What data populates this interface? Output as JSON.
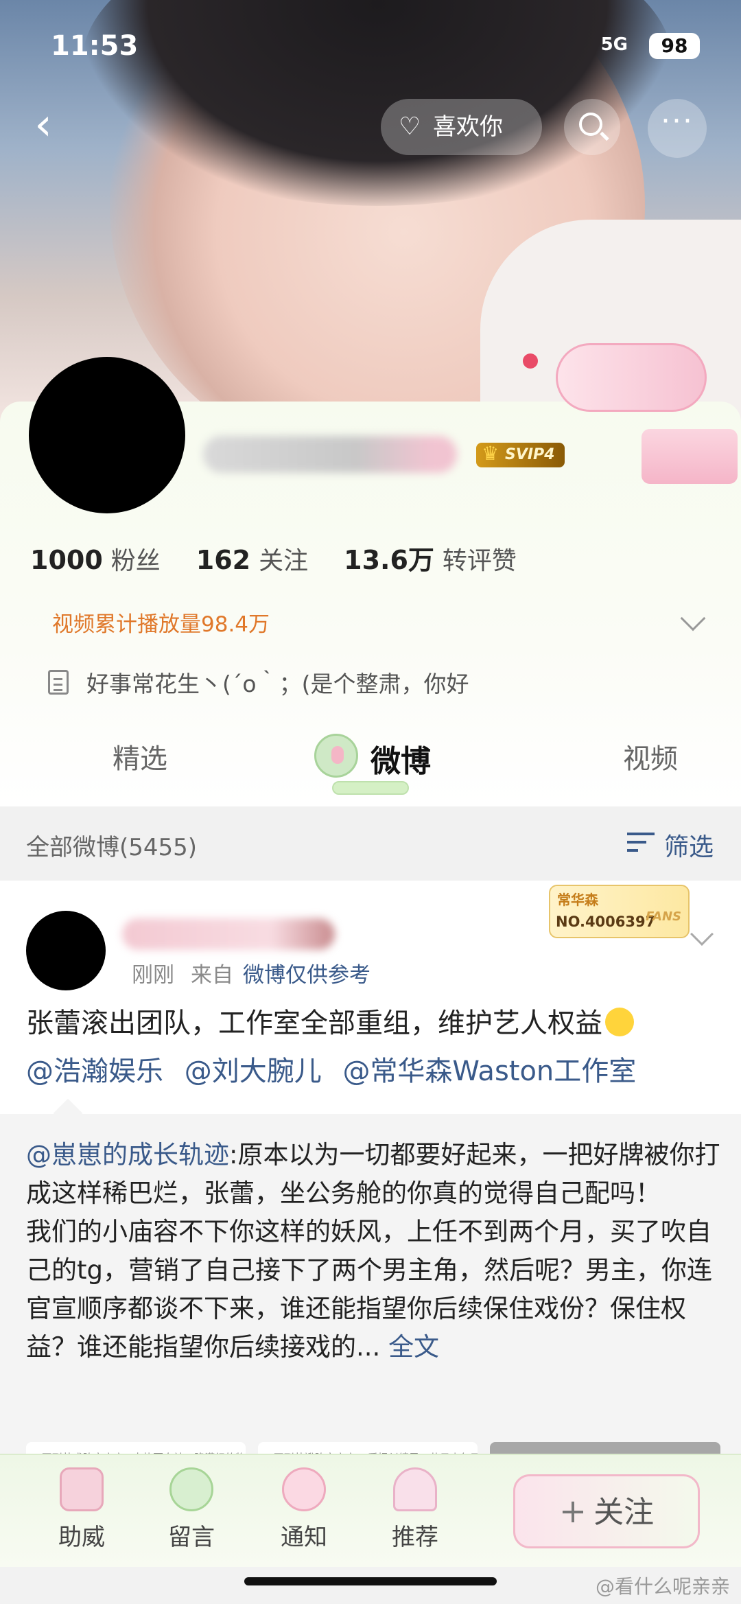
{
  "status_bar": {
    "time": "11:53",
    "network": "5G",
    "battery": "98"
  },
  "header": {
    "like_label": "喜欢你"
  },
  "profile": {
    "badge": "SVIP4",
    "stats": [
      {
        "value": "1000",
        "label": "粉丝"
      },
      {
        "value": "162",
        "label": "关注"
      },
      {
        "value": "13.6万",
        "label": "转评赞"
      }
    ],
    "video_plays": "视频累计播放量98.4万",
    "bio": "好事常花生丶(´o｀；(是个整肃，你好"
  },
  "tabs": [
    {
      "label": "精选"
    },
    {
      "label": "微博",
      "active": true
    },
    {
      "label": "视频"
    }
  ],
  "filter_bar": {
    "all_label": "全部微博(5455)",
    "filter_label": "筛选"
  },
  "post": {
    "fan_badge": {
      "name": "常华森",
      "number": "NO.4006397",
      "tag": "FANS"
    },
    "time": "刚刚",
    "from_label": "来自",
    "source": "微博仅供参考",
    "text": "张蕾滚出团队，工作室全部重组，维护艺人权益",
    "mentions": [
      "@浩瀚娱乐",
      "@刘大腕儿",
      "@常华森Waston工作室"
    ],
    "repost": {
      "author": "@崽崽的成长轨迹",
      "text": ":原本以为一切都要好起来，一把好牌被你打成这样稀巴烂，张蕾，坐公务舱的你真的觉得自己配吗！\n我们的小庙容不下你这样的妖风，上任不到两个月，买了吹自己的tg，营销了自己接下了两个男主角，然后呢？男主，你连官宣顺序都谈不下来，谁还能指望你后续保住戏份？保住权益？谁还能指望你后续接戏的...",
      "full_label": "全文",
      "thumbs": [
        "#开到茶惑阵容官宣#水热要向社，降满织的物乞",
        "#开到茶瓣阵容官宣# 爱恨纠缠里，昔日少年正在恨"
      ]
    }
  },
  "bottom_bar": {
    "items": [
      {
        "label": "助威",
        "icon": "cup-icon"
      },
      {
        "label": "留言",
        "icon": "rice-ball-icon"
      },
      {
        "label": "通知",
        "icon": "flower-icon"
      },
      {
        "label": "推荐",
        "icon": "umbrella-icon"
      }
    ],
    "follow_label": "关注"
  },
  "watermark": "@看什么呢亲亲"
}
